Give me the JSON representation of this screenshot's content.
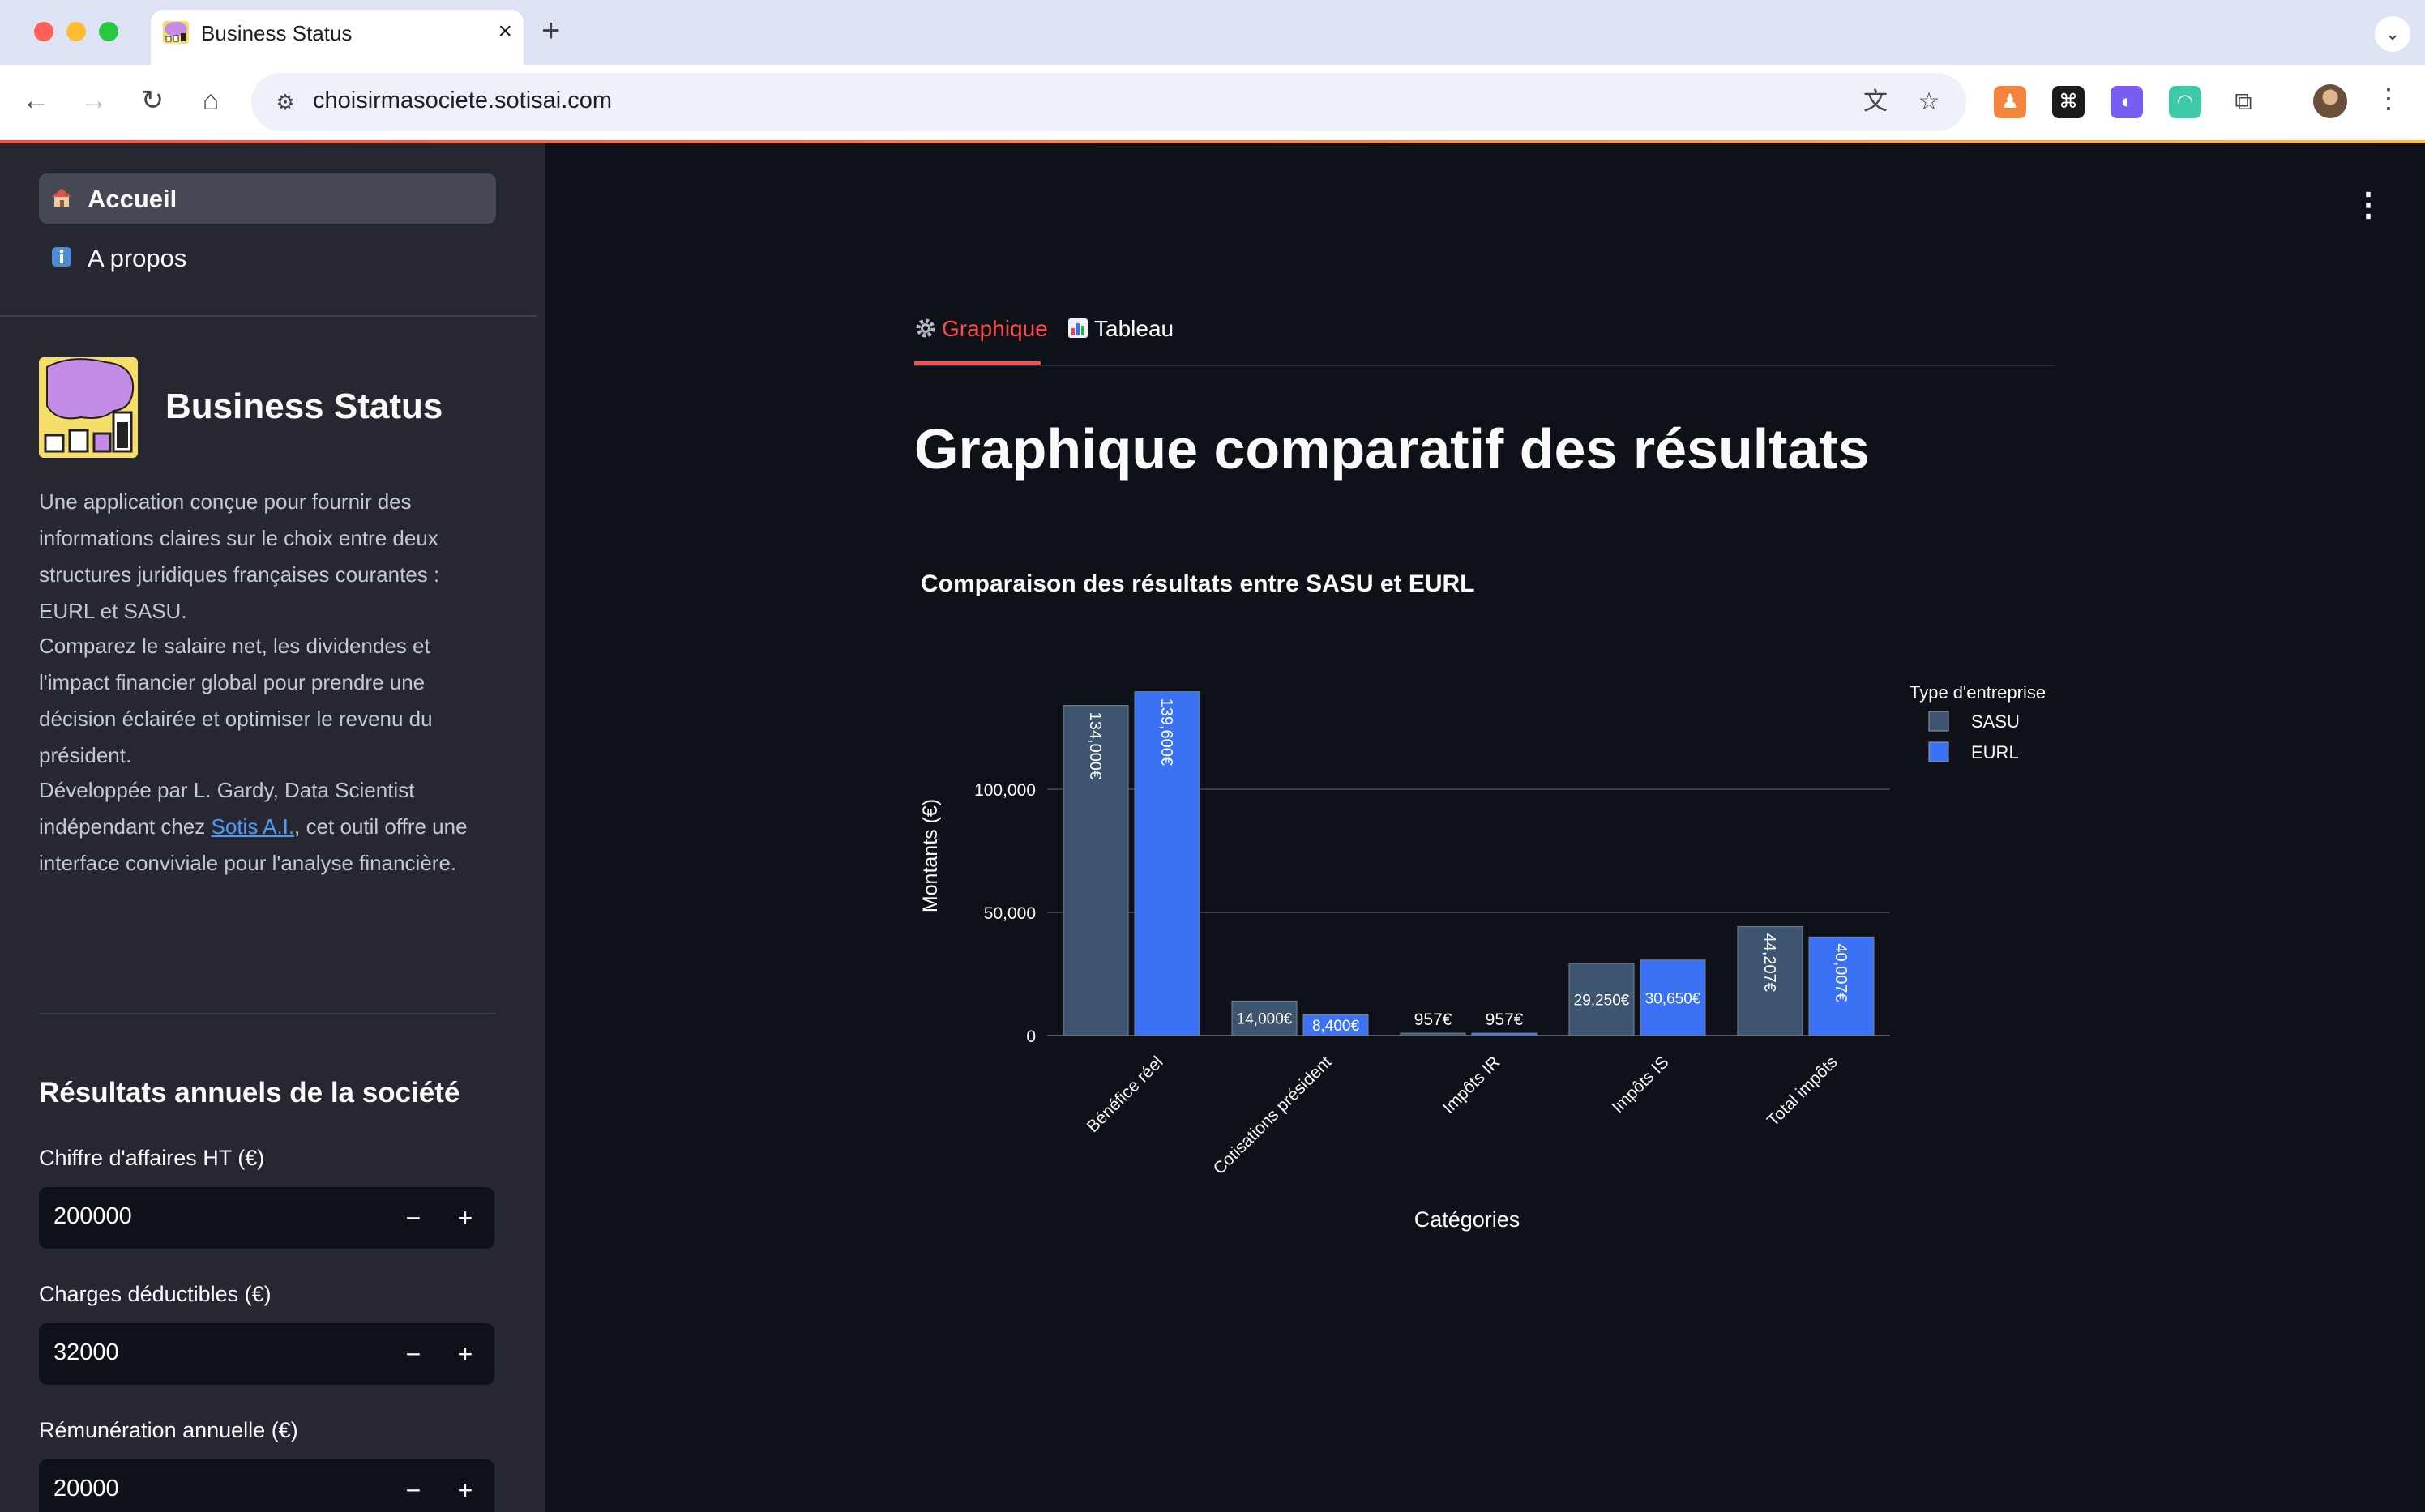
{
  "browser": {
    "tab_title": "Business Status",
    "new_tab": "+",
    "tab_close": "×",
    "url": "choisirmasociete.sotisai.com"
  },
  "sidebar": {
    "nav": [
      {
        "label": "Accueil",
        "active": true
      },
      {
        "label": "A propos",
        "active": false
      }
    ],
    "app_title": "Business Status",
    "paragraphs": {
      "intro": "Une application conçue pour fournir des informations claires sur le choix entre deux structures juridiques françaises courantes : EURL et SASU.",
      "compare": "Comparez le salaire net, les dividendes et l'impact financier global pour prendre une décision éclairée et optimiser le revenu du président.",
      "credit_before": "Développée par L. Gardy, Data Scientist indépendant chez ",
      "credit_link": "Sotis A.I.",
      "credit_after": ", cet outil offre une interface conviviale pour l'analyse financière."
    },
    "section_title": "Résultats annuels de la société",
    "fields": [
      {
        "label": "Chiffre d'affaires HT (€)",
        "value": "200000"
      },
      {
        "label": "Charges déductibles (€)",
        "value": "32000"
      },
      {
        "label": "Rémunération annuelle (€)",
        "value": "20000"
      }
    ],
    "minus": "−",
    "plus": "+"
  },
  "main": {
    "tabs": [
      {
        "label": "Graphique",
        "icon": "gear-icon",
        "active": true
      },
      {
        "label": "Tableau",
        "icon": "bar-chart-icon",
        "active": false
      }
    ],
    "page_title": "Graphique comparatif des résultats"
  },
  "colors": {
    "sasu": "#3e5571",
    "eurl": "#3b72f5",
    "accent": "#ff4b4b",
    "background": "#0e1117",
    "sidebar": "#262730"
  },
  "chart_data": {
    "type": "bar",
    "title": "Comparaison des résultats entre SASU et EURL",
    "xlabel": "Catégories",
    "ylabel": "Montants (€)",
    "legend_title": "Type d'entreprise",
    "legend_position": "top-right",
    "grid": true,
    "ylim": [
      0,
      140000
    ],
    "yticks": [
      0,
      50000,
      100000
    ],
    "ytick_labels": [
      "0",
      "50,000",
      "100,000"
    ],
    "categories": [
      "Bénéfice réel",
      "Cotisations président",
      "Impôts IR",
      "Impôts IS",
      "Total impôts"
    ],
    "series": [
      {
        "name": "SASU",
        "values": [
          134000,
          14000,
          957,
          29250,
          44207
        ],
        "labels": [
          "134,000€",
          "14,000€",
          "957€",
          "29,250€",
          "44,207€"
        ]
      },
      {
        "name": "EURL",
        "values": [
          139600,
          8400,
          957,
          30650,
          40007
        ],
        "labels": [
          "139,600€",
          "8,400€",
          "957€",
          "30,650€",
          "40,007€"
        ]
      }
    ]
  }
}
